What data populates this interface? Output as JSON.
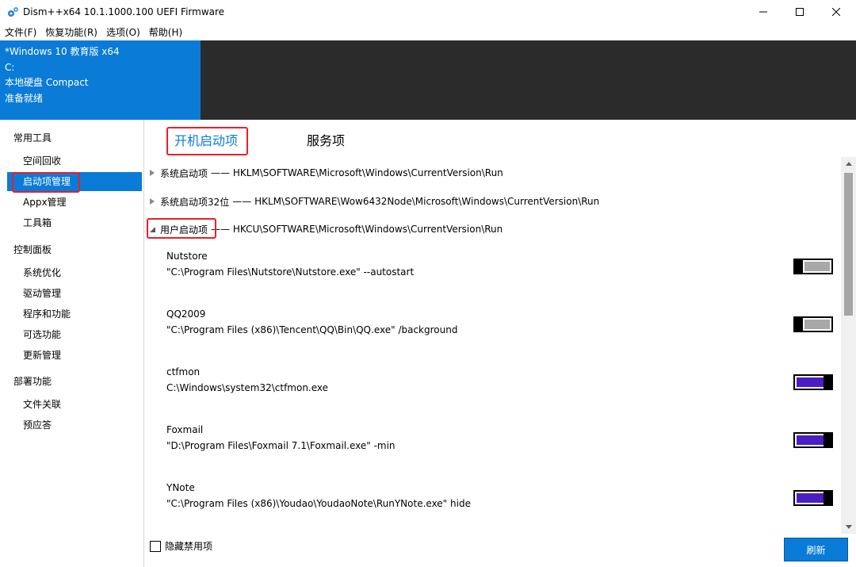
{
  "window": {
    "title": "Dism++x64 10.1.1000.100 UEFI Firmware",
    "icon": "gears-icon"
  },
  "menu": [
    "文件(F)",
    "恢复功能(R)",
    "选项(O)",
    "帮助(H)"
  ],
  "info": {
    "os": "*Windows 10 教育版 x64",
    "drive": "C:",
    "disk": "本地硬盘 Compact",
    "status": "准备就绪"
  },
  "sidebar": {
    "groups": [
      {
        "label": "常用工具",
        "items": [
          "空间回收",
          "启动项管理",
          "Appx管理",
          "工具箱"
        ]
      },
      {
        "label": "控制面板",
        "items": [
          "系统优化",
          "驱动管理",
          "程序和功能",
          "可选功能",
          "更新管理"
        ]
      },
      {
        "label": "部署功能",
        "items": [
          "文件关联",
          "预应答"
        ]
      }
    ],
    "selected": "启动项管理"
  },
  "tabs": [
    "开机启动项",
    "服务项"
  ],
  "active_tab": "开机启动项",
  "sections": [
    {
      "label": "系统启动项",
      "path": "—— HKLM\\SOFTWARE\\Microsoft\\Windows\\CurrentVersion\\Run",
      "expanded": false
    },
    {
      "label": "系统启动项32位",
      "path": "—— HKLM\\SOFTWARE\\Wow6432Node\\Microsoft\\Windows\\CurrentVersion\\Run",
      "expanded": false
    },
    {
      "label": "用户启动项",
      "path": "—— HKCU\\SOFTWARE\\Microsoft\\Windows\\CurrentVersion\\Run",
      "expanded": true
    }
  ],
  "entries": [
    {
      "name": "Nutstore",
      "cmd": "\"C:\\Program Files\\Nutstore\\Nutstore.exe\" --autostart",
      "enabled": false
    },
    {
      "name": "QQ2009",
      "cmd": "\"C:\\Program Files (x86)\\Tencent\\QQ\\Bin\\QQ.exe\" /background",
      "enabled": false
    },
    {
      "name": "ctfmon",
      "cmd": "C:\\Windows\\system32\\ctfmon.exe",
      "enabled": true
    },
    {
      "name": "Foxmail",
      "cmd": "\"D:\\Program Files\\Foxmail 7.1\\Foxmail.exe\" -min",
      "enabled": true
    },
    {
      "name": "YNote",
      "cmd": "\"C:\\Program Files (x86)\\Youdao\\YoudaoNote\\RunYNote.exe\" hide",
      "enabled": true
    }
  ],
  "footer": {
    "hide_disabled_label": "隐藏禁用项",
    "hide_disabled_checked": false,
    "refresh_label": "刷新"
  },
  "colors": {
    "accent": "#0a7bd7",
    "toggle_on": "#4a1ec4",
    "highlight_box": "#e8202a"
  }
}
